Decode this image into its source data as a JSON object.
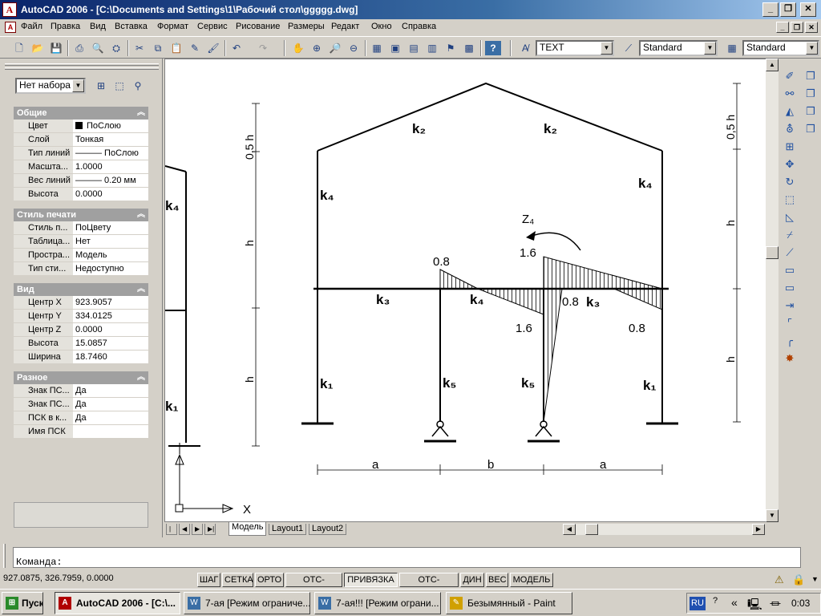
{
  "window": {
    "title": "AutoCAD 2006 - [C:\\Documents and Settings\\1\\Рабочий стол\\ggggg.dwg]",
    "min": "_",
    "max": "▫",
    "close": "✕"
  },
  "menu": [
    "Файл",
    "Правка",
    "Вид",
    "Вставка",
    "Формат",
    "Сервис",
    "Рисование",
    "Размеры",
    "Редакт",
    "Окно",
    "Справка"
  ],
  "toolbar": {
    "text_style": "TEXT",
    "dim_style": "Standard",
    "table_style": "Standard"
  },
  "palette": {
    "selection": "Нет набора",
    "sections": [
      {
        "title": "Общие",
        "rows": [
          {
            "label": "Цвет",
            "value": "ПоСлою"
          },
          {
            "label": "Слой",
            "value": "Тонкая"
          },
          {
            "label": "Тип линий",
            "value": "——— ПоСлою"
          },
          {
            "label": "Масшта...",
            "value": "1.0000"
          },
          {
            "label": "Вес линий",
            "value": "——— 0.20 мм"
          },
          {
            "label": "Высота",
            "value": "0.0000"
          }
        ]
      },
      {
        "title": "Стиль печати",
        "rows": [
          {
            "label": "Стиль п...",
            "value": "ПоЦвету"
          },
          {
            "label": "Таблица...",
            "value": "Нет"
          },
          {
            "label": "Простра...",
            "value": "Модель"
          },
          {
            "label": "Тип сти...",
            "value": "Недоступно"
          }
        ]
      },
      {
        "title": "Вид",
        "rows": [
          {
            "label": "Центр X",
            "value": "923.9057"
          },
          {
            "label": "Центр Y",
            "value": "334.0125"
          },
          {
            "label": "Центр Z",
            "value": "0.0000"
          },
          {
            "label": "Высота",
            "value": "15.0857"
          },
          {
            "label": "Ширина",
            "value": "18.7460"
          }
        ]
      },
      {
        "title": "Разное",
        "rows": [
          {
            "label": "Знак ПС...",
            "value": "Да"
          },
          {
            "label": "Знак ПС...",
            "value": "Да"
          },
          {
            "label": "ПСК в к...",
            "value": "Да"
          },
          {
            "label": "Имя ПСК",
            "value": ""
          }
        ]
      }
    ]
  },
  "drawing_labels": {
    "k2": "k₂",
    "k4": "k₄",
    "k3": "k₃",
    "k1": "k₁",
    "k5": "k₅",
    "z4": "Z₄",
    "v08": "0.8",
    "v16": "1.6",
    "h05": "0,5 h",
    "h": "h",
    "a": "a",
    "b": "b",
    "x": "X"
  },
  "tabs": [
    "Модель",
    "Layout1",
    "Layout2"
  ],
  "command": {
    "prompt": "Команда:"
  },
  "status": {
    "coords": "927.0875, 326.7959, 0.0000",
    "buttons": [
      "ШАГ",
      "СЕТКА",
      "ОРТО",
      "ОТС-ПОЛЯР",
      "ПРИВЯЗКА",
      "ОТС-ОБЪЕКТ",
      "ДИН",
      "ВЕС",
      "МОДЕЛЬ"
    ],
    "active": [
      false,
      false,
      false,
      false,
      true,
      false,
      false,
      false,
      false
    ]
  },
  "taskbar": {
    "start": "Пуск",
    "tasks": [
      "AutoCAD 2006 - [C:\\...",
      "7-ая [Режим ограниче...",
      "7-ая!!! [Режим ограни...",
      "Безымянный - Paint"
    ],
    "lang": "RU",
    "clock": "0:03"
  }
}
